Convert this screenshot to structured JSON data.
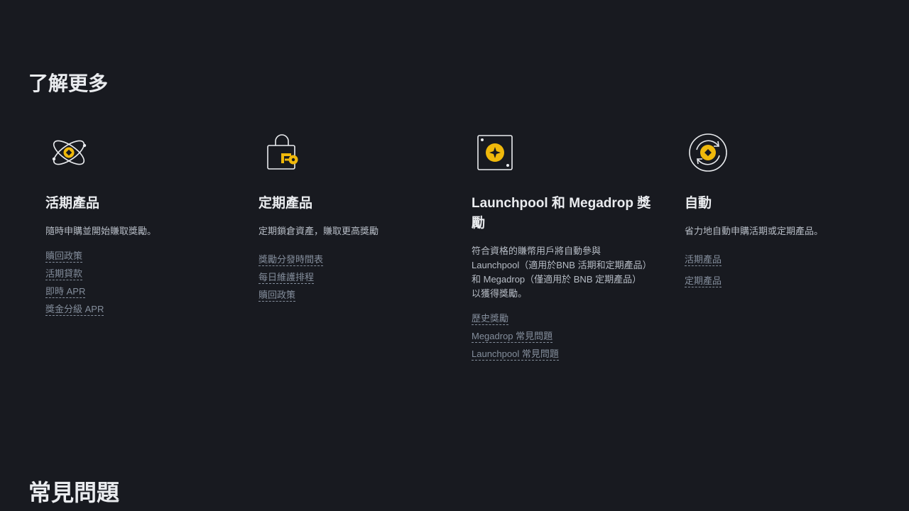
{
  "learn_more": {
    "title": "了解更多"
  },
  "cards": [
    {
      "icon": "atom-orbit-icon",
      "title": "活期產品",
      "description": "隨時申購並開始賺取獎勵。",
      "links": [
        "贖回政策",
        "活期貸款",
        "即時 APR",
        "獎金分級 APR"
      ]
    },
    {
      "icon": "lock-key-icon",
      "title": "定期產品",
      "description": "定期鎖倉資產，賺取更高獎勵",
      "links": [
        "獎勵分發時間表",
        "每日維護排程",
        "贖回政策"
      ]
    },
    {
      "icon": "star-box-icon",
      "title": "Launchpool 和 Megadrop 獎勵",
      "description": "符合資格的賺幣用戶將自動參與 Launchpool（適用於BNB 活期和定期產品）和 Megadrop（僅適用於 BNB 定期產品）以獲得獎勵。",
      "links": [
        "歷史獎勵",
        "Megadrop 常見問題",
        "Launchpool 常見問題"
      ]
    },
    {
      "icon": "auto-cycle-coin-icon",
      "title": "自動",
      "description": "省力地自動申購活期或定期產品。",
      "links": [
        "活期產品",
        "定期產品"
      ]
    }
  ],
  "faq": {
    "title": "常見問題"
  },
  "colors": {
    "background": "#181a20",
    "accent": "#f0b90b",
    "text_primary": "#eaecef",
    "text_secondary": "#b7bdc6",
    "link": "#848e9c"
  }
}
